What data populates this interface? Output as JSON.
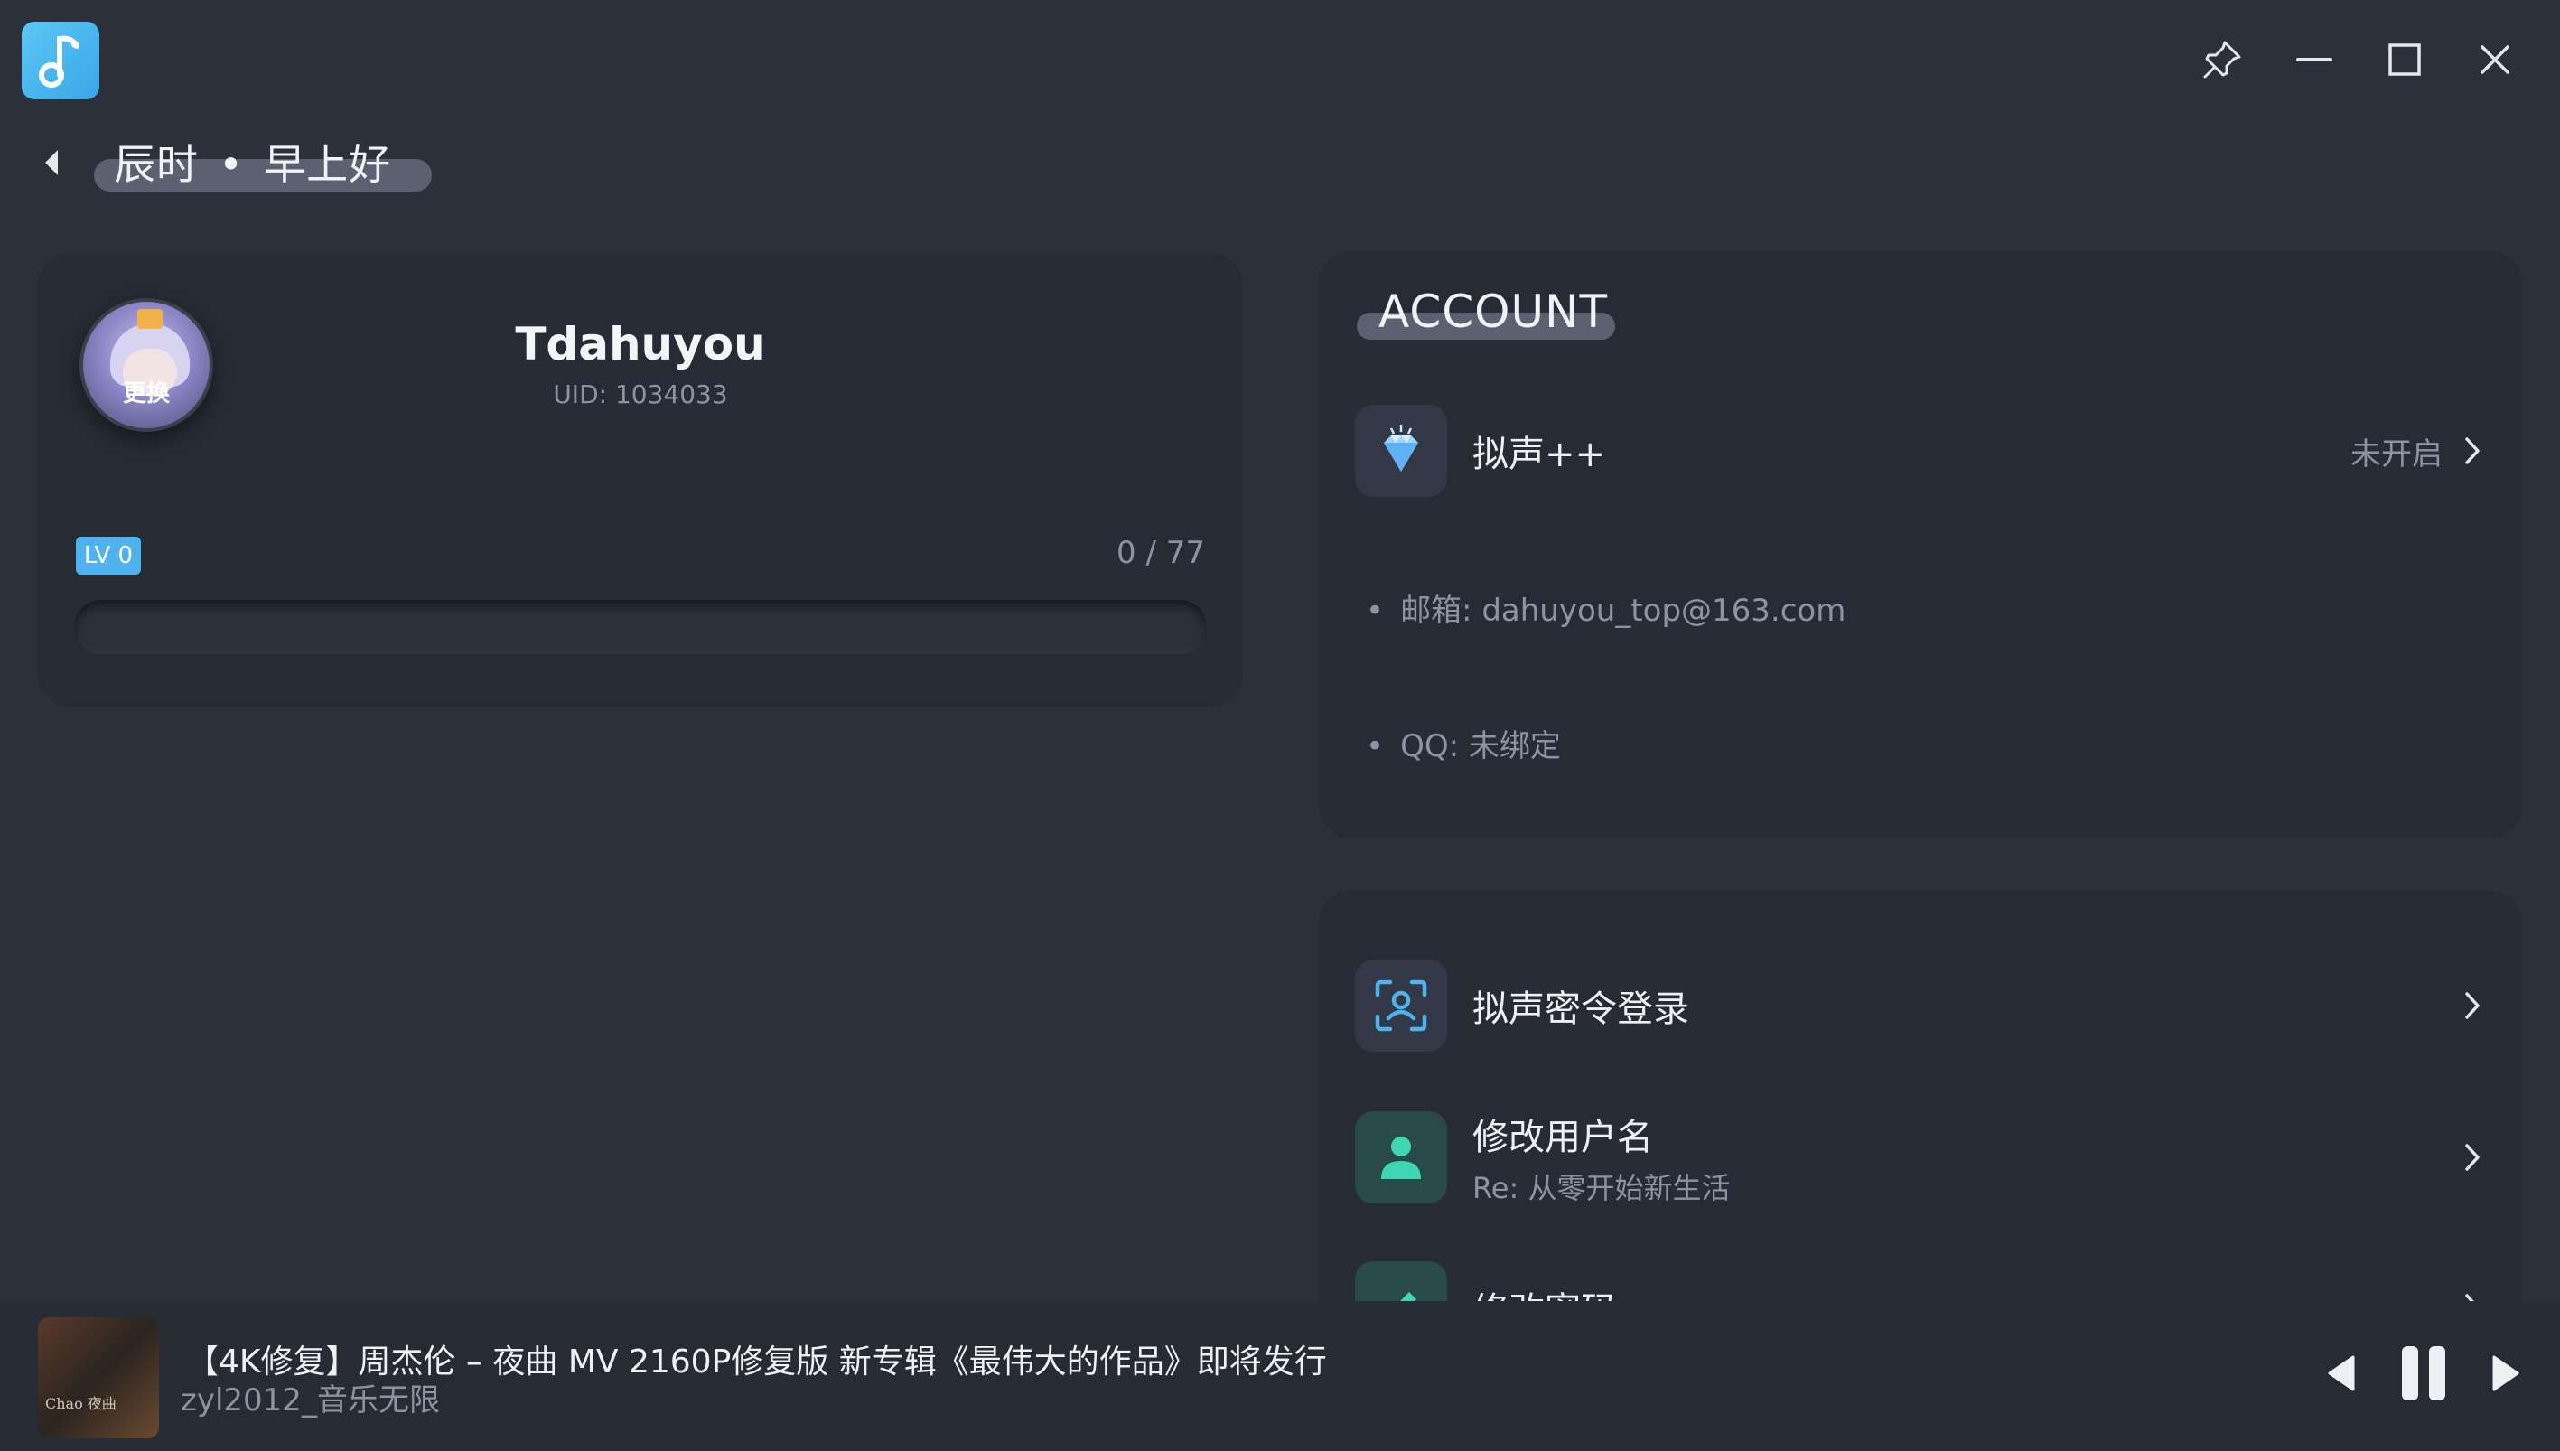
{
  "titlebar": {
    "logo_icon": "music-note-icon",
    "pin_icon": "pin-icon",
    "minimize_icon": "minimize-icon",
    "maximize_icon": "maximize-icon",
    "close_icon": "close-icon"
  },
  "header": {
    "greeting_time": "辰时",
    "greeting_separator": "•",
    "greeting_text": "早上好"
  },
  "profile": {
    "avatar_change_label": "更换",
    "username": "Tdahuyou",
    "uid": "UID: 1034033",
    "level_badge": "LV 0",
    "exp_text": "0 / 77",
    "exp_fraction": 0
  },
  "account": {
    "title": "ACCOUNT",
    "vip_label": "拟声++",
    "vip_status": "未开启",
    "email_line": "邮箱: dahuyou_top@163.com",
    "qq_line": "QQ: 未绑定"
  },
  "settings": {
    "items": [
      {
        "label": "拟声密令登录",
        "sub": ""
      },
      {
        "label": "修改用户名",
        "sub": "Re: 从零开始新生活"
      },
      {
        "label": "修改密码",
        "sub": ""
      }
    ]
  },
  "player": {
    "cover_text": "Chao 夜曲",
    "song_title": "【4K修复】周杰伦 – 夜曲 MV 2160P修复版 新专辑《最伟大的作品》即将发行",
    "song_artist": "zyl2012_音乐无限",
    "state": "playing"
  },
  "colors": {
    "background": "#2b303b",
    "card": "#262b35",
    "accent": "#4fb2ec",
    "teal_icon": "#3fd6b4"
  }
}
